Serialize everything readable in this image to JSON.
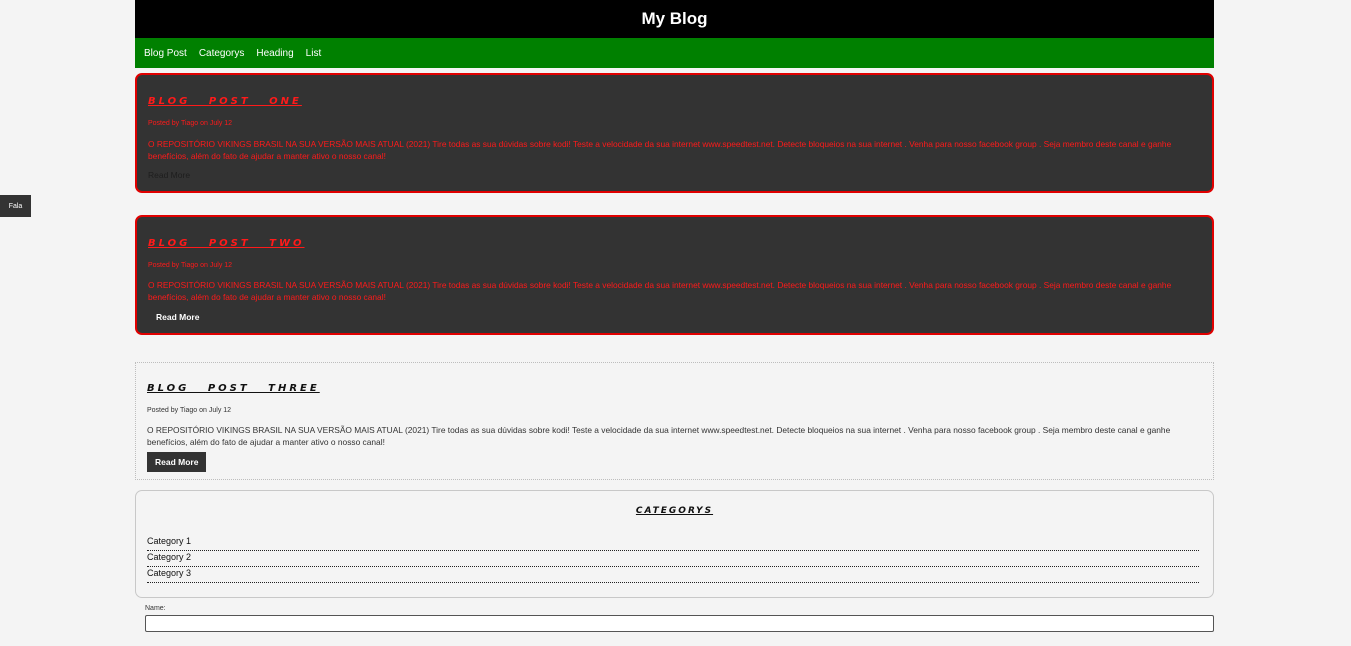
{
  "header": {
    "title": "My Blog"
  },
  "nav": {
    "items": [
      {
        "label": "Blog Post"
      },
      {
        "label": "Categorys"
      },
      {
        "label": "Heading"
      },
      {
        "label": "List"
      }
    ]
  },
  "side_tab": {
    "label": "Fala"
  },
  "posts": [
    {
      "title": "BLOG POST ONE",
      "meta": "Posted by Tiago on July 12",
      "body": "O REPOSITÓRIO VIKINGS BRASIL NA SUA VERSÃO MAIS ATUAL (2021) Tire todas as sua dúvidas sobre kodi! Teste a velocidade da sua internet www.speedtest.net. Detecte bloqueios na sua internet . Venha para nosso facebook group . Seja membro deste canal e ganhe benefícios, além do fato de ajudar a manter ativo o nosso canal!",
      "read_more": "Read More"
    },
    {
      "title": "BLOG POST TWO",
      "meta": "Posted by Tiago on July 12",
      "body": "O REPOSITÓRIO VIKINGS BRASIL NA SUA VERSÃO MAIS ATUAL (2021) Tire todas as sua dúvidas sobre kodi! Teste a velocidade da sua internet www.speedtest.net. Detecte bloqueios na sua internet . Venha para nosso facebook group . Seja membro deste canal e ganhe benefícios, além do fato de ajudar a manter ativo o nosso canal!",
      "read_more": "Read More"
    },
    {
      "title": "BLOG POST THREE",
      "meta": "Posted by Tiago on July 12",
      "body": "O REPOSITÓRIO VIKINGS BRASIL NA SUA VERSÃO MAIS ATUAL (2021) Tire todas as sua dúvidas sobre kodi! Teste a velocidade da sua internet www.speedtest.net. Detecte bloqueios na sua internet . Venha para nosso facebook group . Seja membro deste canal e ganhe benefícios, além do fato de ajudar a manter ativo o nosso canal!",
      "read_more": "Read More"
    }
  ],
  "categories": {
    "title": "CATEGORYS",
    "items": [
      "Category 1",
      "Category 2",
      "Category 3"
    ]
  },
  "form": {
    "name_label": "Name:",
    "name_value": ""
  },
  "colors": {
    "header_bg": "#000000",
    "nav_bg": "#008000",
    "post_dark_bg": "#333333",
    "post_border": "#e00000",
    "post_text": "#ff1a1a"
  }
}
